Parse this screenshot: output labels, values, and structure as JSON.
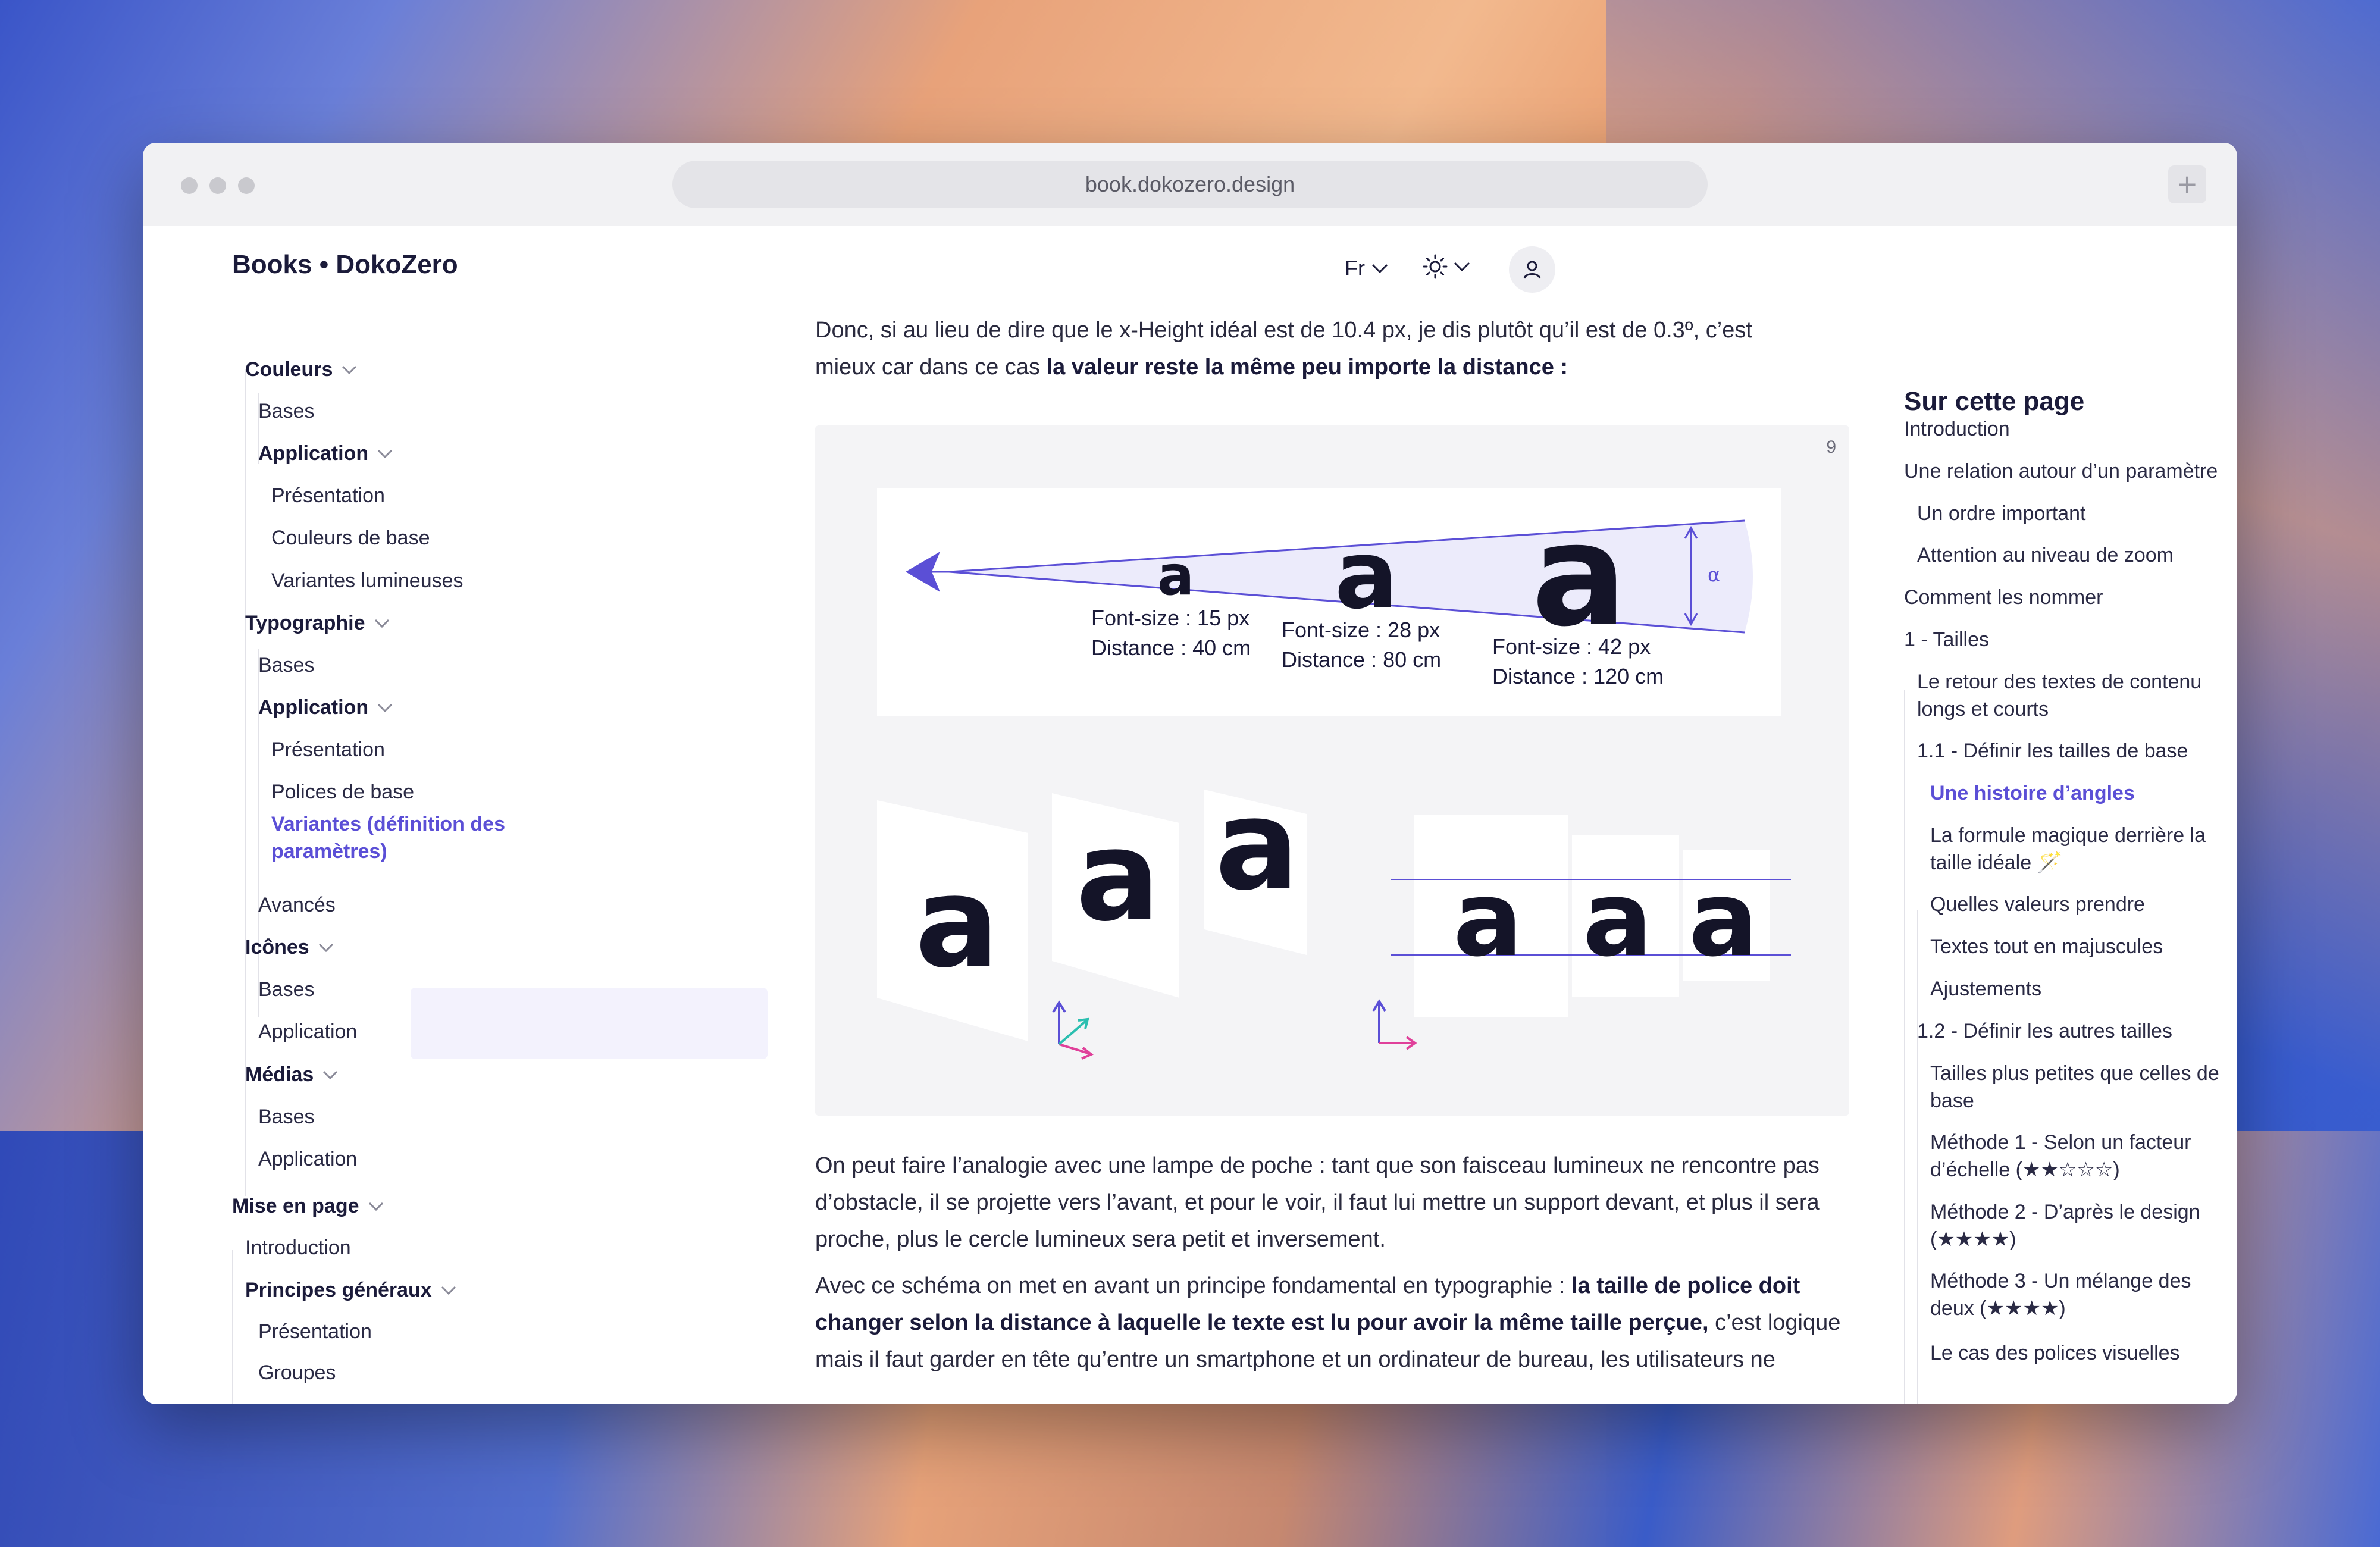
{
  "browser": {
    "url": "book.dokozero.design"
  },
  "header": {
    "brand": "Books • DokoZero",
    "language": "Fr"
  },
  "sidebar": {
    "items": [
      {
        "label": "Couleurs",
        "level": 1,
        "bold": true,
        "chevron": true
      },
      {
        "label": "Bases",
        "level": 2
      },
      {
        "label": "Application",
        "level": 2,
        "bold": true,
        "chevron": true
      },
      {
        "label": "Présentation",
        "level": 3
      },
      {
        "label": "Couleurs de base",
        "level": 3
      },
      {
        "label": "Variantes lumineuses",
        "level": 3
      },
      {
        "label": "Typographie",
        "level": 1,
        "bold": true,
        "chevron": true
      },
      {
        "label": "Bases",
        "level": 2
      },
      {
        "label": "Application",
        "level": 2,
        "bold": true,
        "chevron": true
      },
      {
        "label": "Présentation",
        "level": 3
      },
      {
        "label": "Polices de base",
        "level": 3
      },
      {
        "label": "Variantes (définition des paramètres)",
        "level": 3,
        "active": true
      },
      {
        "label": "Avancés",
        "level": 2
      },
      {
        "label": "Icônes",
        "level": 1,
        "bold": true,
        "chevron": true
      },
      {
        "label": "Bases",
        "level": 2
      },
      {
        "label": "Application",
        "level": 2
      },
      {
        "label": "Médias",
        "level": 1,
        "bold": true,
        "chevron": true
      },
      {
        "label": "Bases",
        "level": 2
      },
      {
        "label": "Application",
        "level": 2
      },
      {
        "label": "Mise en page",
        "level": 0,
        "bold": true,
        "chevron": true
      },
      {
        "label": "Introduction",
        "level": 1
      },
      {
        "label": "Principes généraux",
        "level": 1,
        "bold": true,
        "chevron": true
      },
      {
        "label": "Présentation",
        "level": 2
      },
      {
        "label": "Groupes",
        "level": 2
      }
    ]
  },
  "main": {
    "intro_line1": "Donc, si au lieu de dire que le x-Height idéal est de 10.4 px, je dis plutôt qu’il est de 0.3º, c’est",
    "intro_line2_a": "mieux car dans ce cas ",
    "intro_line2_b": "la valeur reste la même peu importe la distance :",
    "figure": {
      "number": "9",
      "angle_label": "α",
      "glyph": "a",
      "samples": [
        {
          "font_size": "Font-size : 15 px",
          "distance": "Distance : 40 cm"
        },
        {
          "font_size": "Font-size : 28 px",
          "distance": "Distance : 80 cm"
        },
        {
          "font_size": "Font-size : 42 px",
          "distance": "Distance : 120 cm"
        }
      ]
    },
    "para2": "On peut faire l’analogie avec une lampe de poche : tant que son faisceau lumineux ne rencontre pas d’obstacle, il se projette vers l’avant, et pour le voir, il faut lui mettre un support devant, et plus il sera proche, plus le cercle lumineux sera petit et inversement.",
    "para3_a": "Avec ce schéma on met en avant un principe fondamental en typographie : ",
    "para3_b": "la taille de police doit changer selon la distance à laquelle le texte est lu pour avoir la même taille perçue,",
    "para3_c": " c’est logique mais il faut garder en tête qu’entre un smartphone et un ordinateur de bureau, les utilisateurs ne"
  },
  "toc": {
    "title": "Sur cette page",
    "items": [
      {
        "label": "Introduction",
        "level": 0
      },
      {
        "label": "Une relation autour d’un paramètre",
        "level": 0
      },
      {
        "label": "Un ordre important",
        "level": 1
      },
      {
        "label": "Attention au niveau de zoom",
        "level": 1
      },
      {
        "label": "Comment les nommer",
        "level": 0
      },
      {
        "label": "1 - Tailles",
        "level": 0
      },
      {
        "label": "Le retour des textes de contenu longs et courts",
        "level": 1
      },
      {
        "label": "1.1 - Définir les tailles de base",
        "level": 1
      },
      {
        "label": "Une histoire d’angles",
        "level": 2,
        "active": true
      },
      {
        "label": "La formule magique derrière la taille idéale 🪄",
        "level": 2
      },
      {
        "label": "Quelles valeurs prendre",
        "level": 2
      },
      {
        "label": "Textes tout en majuscules",
        "level": 2
      },
      {
        "label": "Ajustements",
        "level": 2
      },
      {
        "label": "1.2 - Définir les autres tailles",
        "level": 1
      },
      {
        "label": "Tailles plus petites que celles de base",
        "level": 2
      },
      {
        "label": "Méthode 1 - Selon un facteur d’échelle (★★☆☆☆)",
        "level": 2
      },
      {
        "label": "Méthode 2 - D’après le design (★★★★)",
        "level": 2
      },
      {
        "label": "Méthode 3 - Un mélange des deux (★★★★)",
        "level": 2
      },
      {
        "label": "Le cas des polices visuelles",
        "level": 2
      }
    ]
  },
  "colors": {
    "accent": "#5b4fd6",
    "text": "#1b1b3a",
    "pink": "#e0409a",
    "teal": "#2bbfb0"
  }
}
